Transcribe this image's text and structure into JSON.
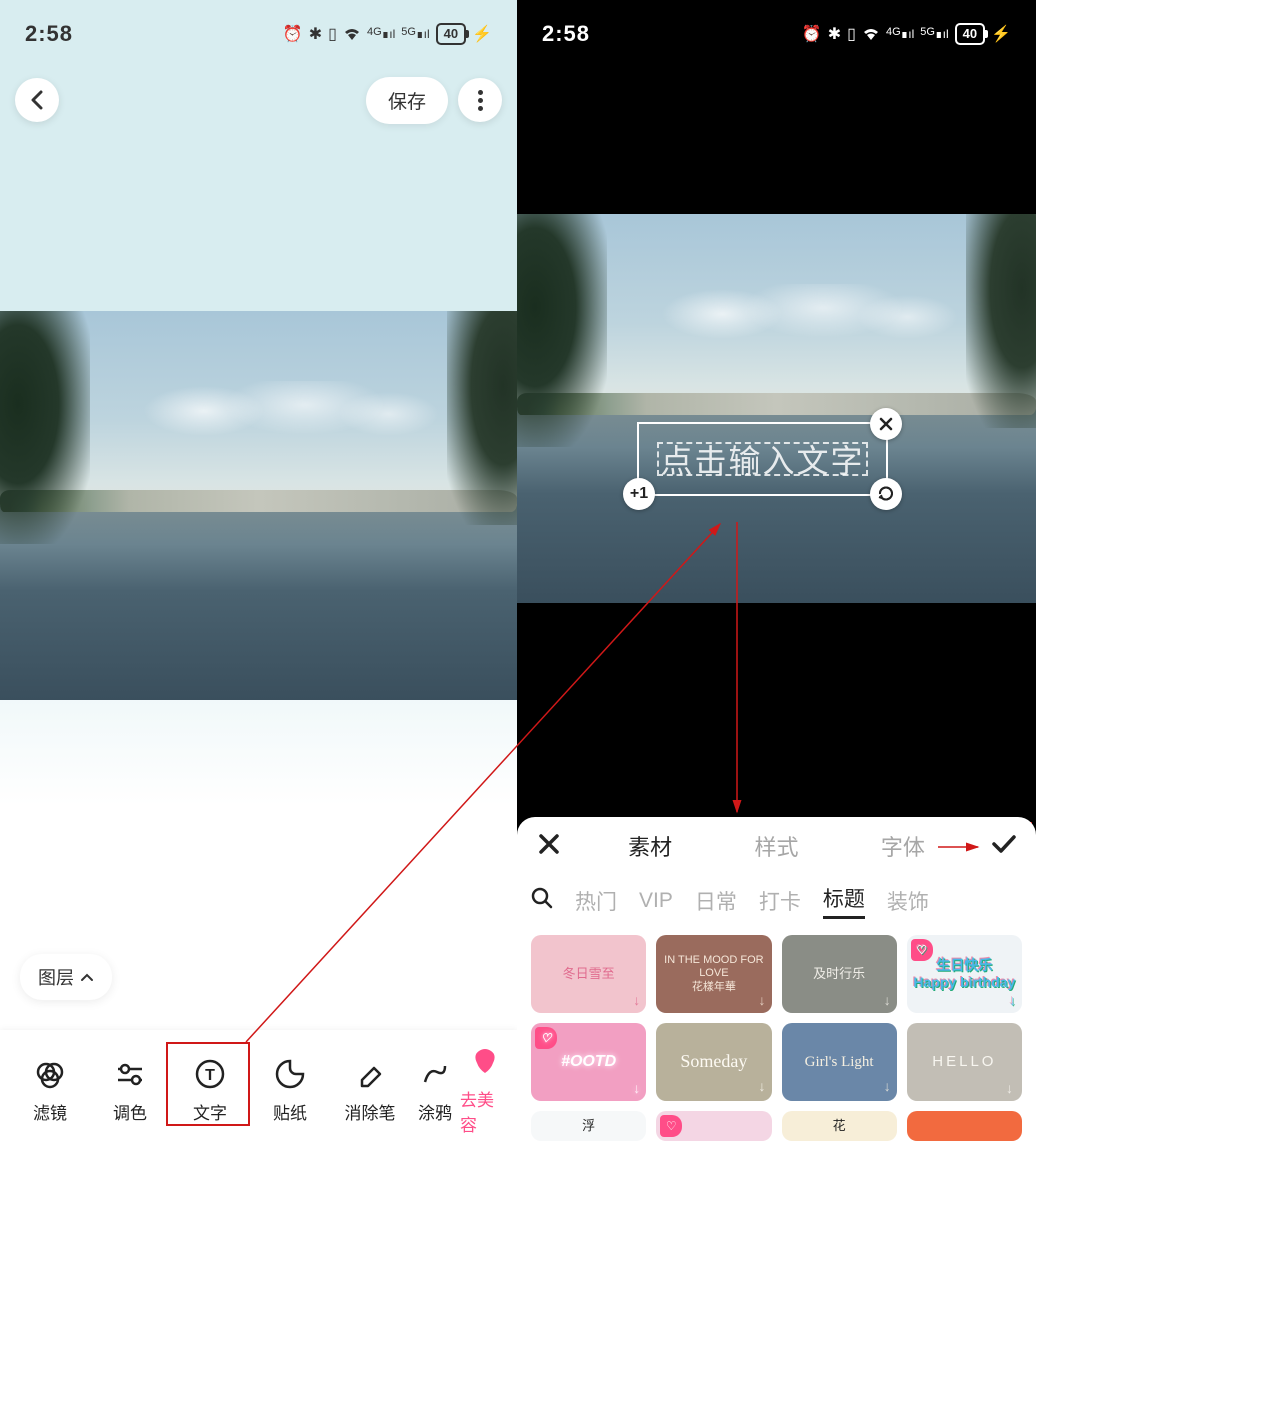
{
  "status_bar": {
    "time": "2:58",
    "battery": "40"
  },
  "left_screen": {
    "save": "保存",
    "layers": "图层",
    "tools": [
      {
        "label": "滤镜"
      },
      {
        "label": "调色"
      },
      {
        "label": "文字"
      },
      {
        "label": "贴纸"
      },
      {
        "label": "消除笔"
      },
      {
        "label": "涂鸦"
      },
      {
        "label": "去美容"
      }
    ]
  },
  "right_screen": {
    "text_placeholder": "点击输入文字",
    "handle_plus": "+1",
    "panel": {
      "tabs": [
        "素材",
        "样式",
        "字体"
      ],
      "active_tab": 0,
      "categories": [
        "热门",
        "VIP",
        "日常",
        "打卡",
        "标题",
        "装饰"
      ],
      "active_category": "标题",
      "stickers": [
        {
          "label": "冬日雪至",
          "bg": "#f2c4cd",
          "color": "#e06b8e",
          "vip": false
        },
        {
          "label": "IN THE MOOD FOR LOVE\n花樣年華",
          "bg": "#9a6b5d",
          "color": "#f5e6d8",
          "vip": false
        },
        {
          "label": "及时行乐",
          "bg": "#8a8d86",
          "color": "#f0eee8",
          "vip": false
        },
        {
          "label": "生日快乐\nHappy birthday",
          "bg": "#eff3f6",
          "color": "#49b8e8",
          "vip": true
        },
        {
          "label": "#OOTD",
          "bg": "#f29fc2",
          "color": "#ffffff",
          "vip": true
        },
        {
          "label": "Someday",
          "bg": "#b8b19b",
          "color": "#fdfaf3",
          "vip": false
        },
        {
          "label": "Girl's Light",
          "bg": "#6a87a8",
          "color": "#f5efe0",
          "vip": false
        },
        {
          "label": "HELLO",
          "bg": "#c2beb5",
          "color": "#f8f6f0",
          "vip": false
        },
        {
          "label": "浮",
          "bg": "#f6f8f9",
          "color": "#222",
          "vip": false
        },
        {
          "label": "",
          "bg": "#f4d6e4",
          "color": "#e06b8e",
          "vip": true
        },
        {
          "label": "花",
          "bg": "#f7eed8",
          "color": "#222",
          "vip": false
        },
        {
          "label": "",
          "bg": "#f26a3f",
          "color": "#fff",
          "vip": false
        }
      ]
    }
  }
}
